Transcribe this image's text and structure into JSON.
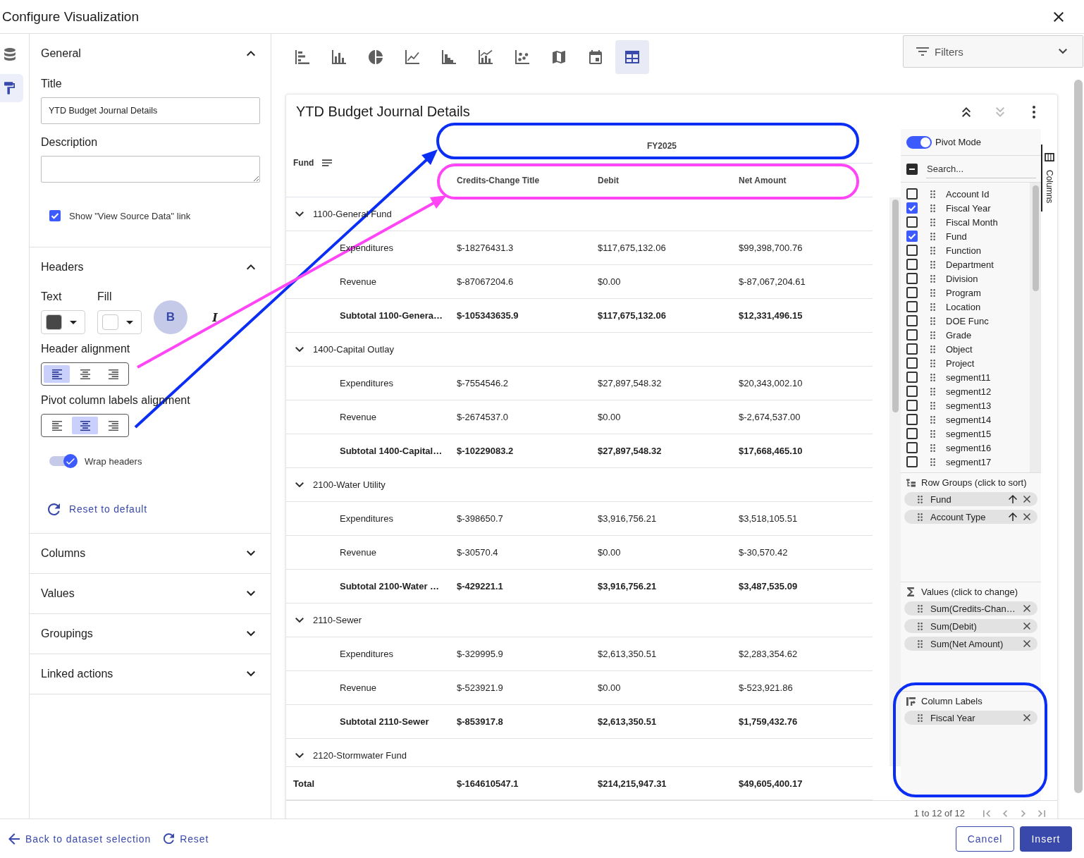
{
  "window": {
    "title": "Configure Visualization"
  },
  "rail": [
    {
      "kind": "dataset",
      "selected": false
    },
    {
      "kind": "format",
      "selected": true
    }
  ],
  "general": {
    "heading": "General",
    "expanded": true,
    "title_label": "Title",
    "title_value": "YTD Budget Journal Details",
    "description_label": "Description",
    "source_link": {
      "label": "Show \"View Source Data\" link",
      "checked": true
    }
  },
  "headers": {
    "heading": "Headers",
    "expanded": true,
    "pickers": [
      {
        "label": "Text",
        "color": "#474747"
      },
      {
        "label": "Fill",
        "color": "#ffffff"
      }
    ],
    "styles": [
      {
        "kind": "bold",
        "label": "B",
        "selected": true
      },
      {
        "kind": "italic",
        "label": "I",
        "selected": false
      }
    ],
    "alignments": [
      {
        "label": "Header alignment",
        "options": [
          {
            "kind": "left",
            "selected": true
          },
          {
            "kind": "center",
            "selected": false
          },
          {
            "kind": "right",
            "selected": false
          }
        ]
      },
      {
        "label": "Pivot column labels alignment",
        "options": [
          {
            "kind": "left",
            "selected": false
          },
          {
            "kind": "center",
            "selected": true
          },
          {
            "kind": "right",
            "selected": false
          }
        ]
      }
    ],
    "wrap": {
      "label": "Wrap headers",
      "on": true
    },
    "reset": "Reset to default"
  },
  "sections": [
    {
      "heading": "Columns",
      "expanded": false
    },
    {
      "heading": "Values",
      "expanded": false
    },
    {
      "heading": "Groupings",
      "expanded": false
    },
    {
      "heading": "Linked actions",
      "expanded": false
    }
  ],
  "chart_types": [
    {
      "kind": "bar_horizontal",
      "selected": false
    },
    {
      "kind": "column",
      "selected": false
    },
    {
      "kind": "pie",
      "selected": false
    },
    {
      "kind": "line",
      "selected": false
    },
    {
      "kind": "step",
      "selected": false
    },
    {
      "kind": "combo",
      "selected": false
    },
    {
      "kind": "scatter",
      "selected": false
    },
    {
      "kind": "map",
      "selected": false
    },
    {
      "kind": "calendar",
      "selected": false
    },
    {
      "kind": "table",
      "selected": true
    }
  ],
  "filters": {
    "label": "Filters"
  },
  "card": {
    "title": "YTD Budget Journal Details",
    "actions": [
      {
        "kind": "expand_all",
        "disabled": false
      },
      {
        "kind": "collapse_all",
        "disabled": true
      },
      {
        "kind": "more",
        "disabled": false
      }
    ]
  },
  "grid": {
    "group_column": "Fund",
    "column_group": "FY2025",
    "columns": [
      "Credits-Change Title",
      "Debit",
      "Net Amount"
    ],
    "rows": [
      {
        "kind": "group",
        "label": "1100-General Fund",
        "expanded": true
      },
      {
        "kind": "leaf",
        "label": "Expenditures",
        "cells": [
          "$-18276431.3",
          "$117,675,132.06",
          "$99,398,700.76"
        ]
      },
      {
        "kind": "leaf",
        "label": "Revenue",
        "cells": [
          "$-87067204.6",
          "$0.00",
          "$-87,067,204.61"
        ]
      },
      {
        "kind": "subtotal",
        "label": "Subtotal 1100-Genera…",
        "cells": [
          "$-105343635.9",
          "$117,675,132.06",
          "$12,331,496.15"
        ]
      },
      {
        "kind": "group",
        "label": "1400-Capital Outlay",
        "expanded": true
      },
      {
        "kind": "leaf",
        "label": "Expenditures",
        "cells": [
          "$-7554546.2",
          "$27,897,548.32",
          "$20,343,002.10"
        ]
      },
      {
        "kind": "leaf",
        "label": "Revenue",
        "cells": [
          "$-2674537.0",
          "$0.00",
          "$-2,674,537.00"
        ]
      },
      {
        "kind": "subtotal",
        "label": "Subtotal 1400-Capital…",
        "cells": [
          "$-10229083.2",
          "$27,897,548.32",
          "$17,668,465.10"
        ]
      },
      {
        "kind": "group",
        "label": "2100-Water Utility",
        "expanded": true
      },
      {
        "kind": "leaf",
        "label": "Expenditures",
        "cells": [
          "$-398650.7",
          "$3,916,756.21",
          "$3,518,105.51"
        ]
      },
      {
        "kind": "leaf",
        "label": "Revenue",
        "cells": [
          "$-30570.4",
          "$0.00",
          "$-30,570.42"
        ]
      },
      {
        "kind": "subtotal",
        "label": "Subtotal 2100-Water …",
        "cells": [
          "$-429221.1",
          "$3,916,756.21",
          "$3,487,535.09"
        ]
      },
      {
        "kind": "group",
        "label": "2110-Sewer",
        "expanded": true
      },
      {
        "kind": "leaf",
        "label": "Expenditures",
        "cells": [
          "$-329995.9",
          "$2,613,350.51",
          "$2,283,354.62"
        ]
      },
      {
        "kind": "leaf",
        "label": "Revenue",
        "cells": [
          "$-523921.9",
          "$0.00",
          "$-523,921.86"
        ]
      },
      {
        "kind": "subtotal",
        "label": "Subtotal 2110-Sewer",
        "cells": [
          "$-853917.8",
          "$2,613,350.51",
          "$1,759,432.76"
        ]
      },
      {
        "kind": "group",
        "label": "2120-Stormwater Fund",
        "expanded": true
      }
    ],
    "total": {
      "label": "Total",
      "cells": [
        "$-164610547.1",
        "$214,215,947.31",
        "$49,605,400.17"
      ]
    },
    "pagination": "1 to 12 of 12"
  },
  "tool_panel": {
    "pivot_mode": {
      "label": "Pivot Mode",
      "on": true
    },
    "select_all": {
      "indeterminate": true
    },
    "search": {
      "placeholder": "Search..."
    },
    "columns": [
      {
        "label": "Account Id",
        "checked": false
      },
      {
        "label": "Fiscal Year",
        "checked": true
      },
      {
        "label": "Fiscal Month",
        "checked": false
      },
      {
        "label": "Fund",
        "checked": true
      },
      {
        "label": "Function",
        "checked": false
      },
      {
        "label": "Department",
        "checked": false
      },
      {
        "label": "Division",
        "checked": false
      },
      {
        "label": "Program",
        "checked": false
      },
      {
        "label": "Location",
        "checked": false
      },
      {
        "label": "DOE Func",
        "checked": false
      },
      {
        "label": "Grade",
        "checked": false
      },
      {
        "label": "Object",
        "checked": false
      },
      {
        "label": "Project",
        "checked": false
      },
      {
        "label": "segment11",
        "checked": false
      },
      {
        "label": "segment12",
        "checked": false
      },
      {
        "label": "segment13",
        "checked": false
      },
      {
        "label": "segment14",
        "checked": false
      },
      {
        "label": "segment15",
        "checked": false
      },
      {
        "label": "segment16",
        "checked": false
      },
      {
        "label": "segment17",
        "checked": false
      }
    ],
    "row_groups": {
      "heading": "Row Groups (click to sort)",
      "chips": [
        {
          "label": "Fund",
          "sort_ascending": true
        },
        {
          "label": "Account Type",
          "sort_ascending": true
        }
      ]
    },
    "values": {
      "heading": "Values (click to change)",
      "chips": [
        {
          "label": "Sum(Credits-Chan…"
        },
        {
          "label": "Sum(Debit)"
        },
        {
          "label": "Sum(Net Amount)"
        }
      ]
    },
    "column_labels": {
      "heading": "Column Labels",
      "chips": [
        {
          "label": "Fiscal Year"
        }
      ]
    },
    "side_tab": {
      "label": "Columns",
      "selected": true
    }
  },
  "footer": {
    "back": "Back to dataset selection",
    "reset": "Reset",
    "cancel": "Cancel",
    "insert": "Insert"
  }
}
